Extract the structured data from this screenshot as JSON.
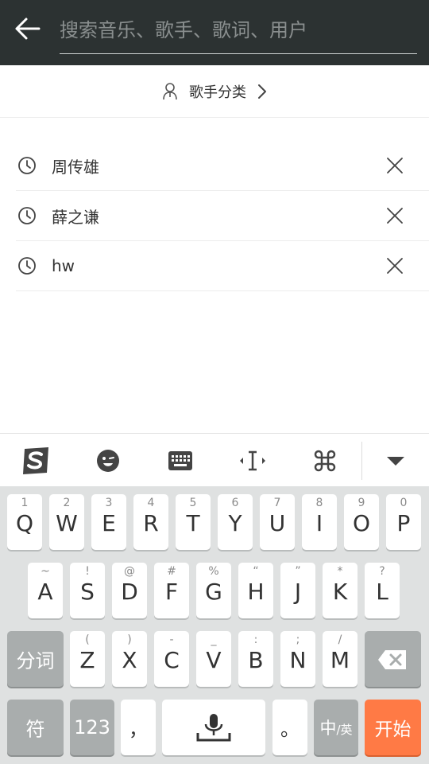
{
  "search": {
    "placeholder": "搜索音乐、歌手、歌词、用户",
    "value": ""
  },
  "singer_category": {
    "label": "歌手分类"
  },
  "history": [
    {
      "text": "周传雄"
    },
    {
      "text": "薛之谦"
    },
    {
      "text": "hw"
    }
  ],
  "ime_toolbar": {
    "icons": [
      "sogou-logo-icon",
      "emoji-icon",
      "keyboard-icon",
      "cursor-move-icon",
      "command-icon",
      "collapse-keyboard-icon"
    ]
  },
  "keyboard": {
    "row1": [
      {
        "sym": "1",
        "main": "Q"
      },
      {
        "sym": "2",
        "main": "W"
      },
      {
        "sym": "3",
        "main": "E"
      },
      {
        "sym": "4",
        "main": "R"
      },
      {
        "sym": "5",
        "main": "T"
      },
      {
        "sym": "6",
        "main": "Y"
      },
      {
        "sym": "7",
        "main": "U"
      },
      {
        "sym": "8",
        "main": "I"
      },
      {
        "sym": "9",
        "main": "O"
      },
      {
        "sym": "0",
        "main": "P"
      }
    ],
    "row2": [
      {
        "sym": "~",
        "main": "A"
      },
      {
        "sym": "!",
        "main": "S"
      },
      {
        "sym": "@",
        "main": "D"
      },
      {
        "sym": "#",
        "main": "F"
      },
      {
        "sym": "%",
        "main": "G"
      },
      {
        "sym": "“",
        "main": "H"
      },
      {
        "sym": "”",
        "main": "J"
      },
      {
        "sym": "*",
        "main": "K"
      },
      {
        "sym": "?",
        "main": "L"
      }
    ],
    "row3": [
      {
        "sym": "(",
        "main": "Z"
      },
      {
        "sym": ")",
        "main": "X"
      },
      {
        "sym": "-",
        "main": "C"
      },
      {
        "sym": "_",
        "main": "V"
      },
      {
        "sym": ":",
        "main": "B"
      },
      {
        "sym": ";",
        "main": "N"
      },
      {
        "sym": "/",
        "main": "M"
      }
    ],
    "fenci_label": "分词",
    "fu_label": "符",
    "num_label": "123",
    "comma_label": "，",
    "period_label": "。",
    "lang_main": "中",
    "lang_sub": "/英",
    "start_label": "开始"
  },
  "colors": {
    "topbar": "#2c3232",
    "keyboard_bg": "#dfe1e1",
    "accent": "#ff7a45"
  }
}
